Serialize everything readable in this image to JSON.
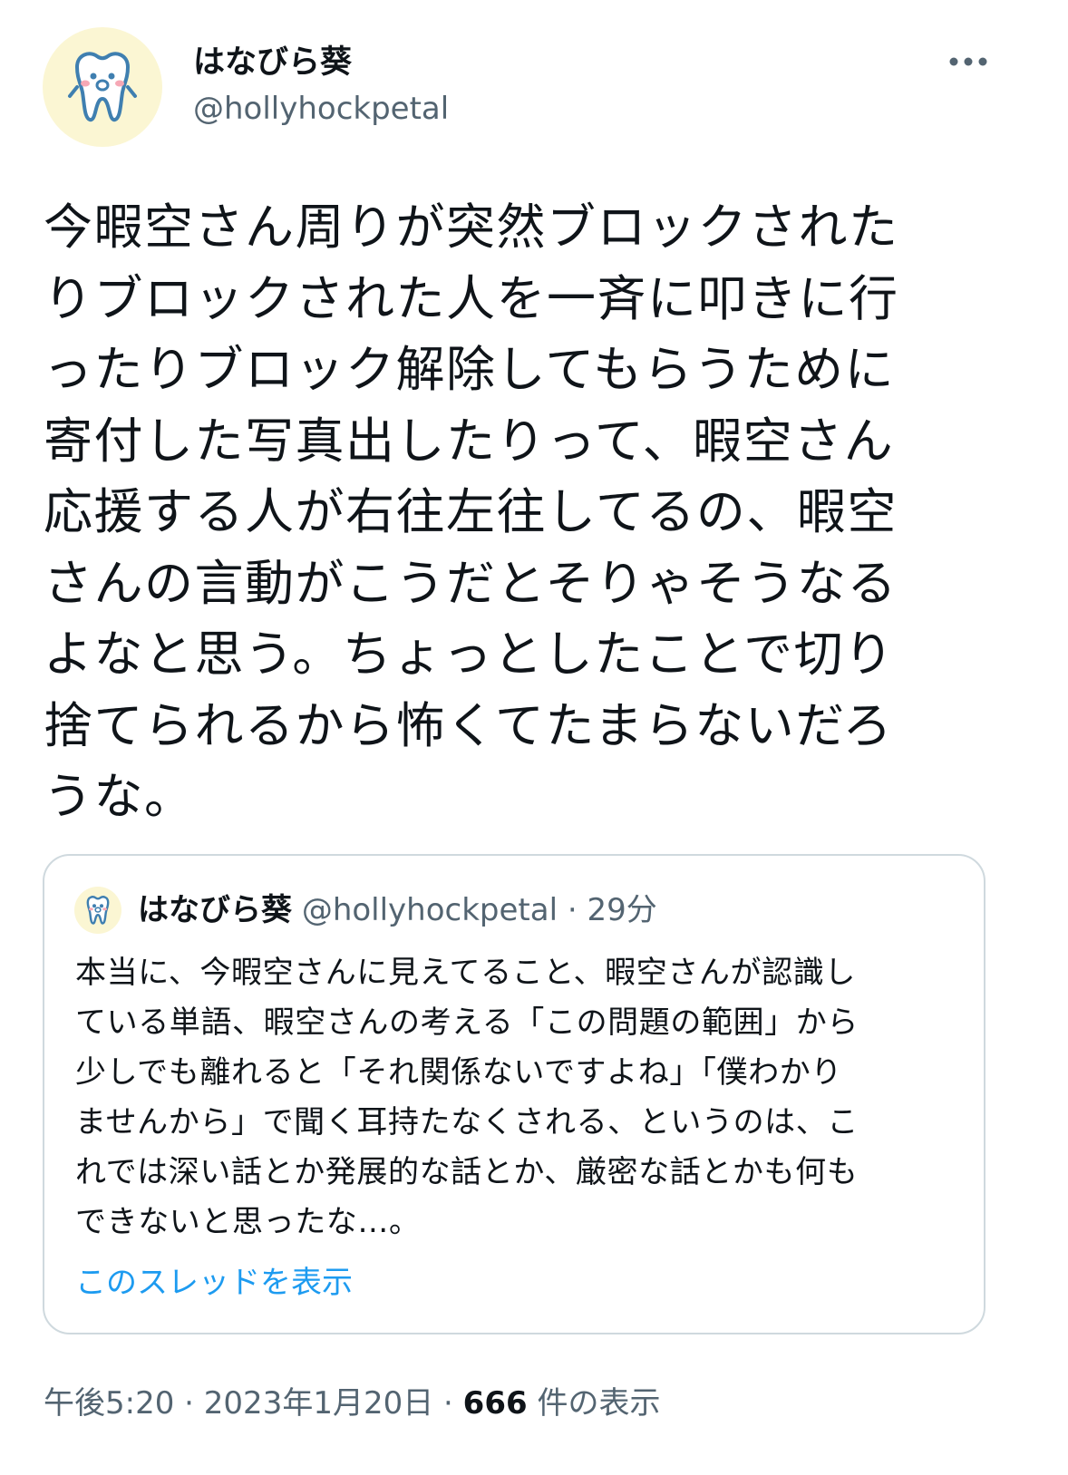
{
  "author": {
    "display_name": "はなびら葵",
    "handle": "@hollyhockpetal",
    "avatar_icon": "tooth-mascot-icon"
  },
  "tweet": {
    "lines": [
      "今暇空さん周りが突然ブロックされた",
      "りブロックされた人を一斉に叩きに行",
      "ったりブロック解除してもらうために",
      "寄付した写真出したりって、暇空さん",
      "応援する人が右往左往してるの、暇空",
      "さんの言動がこうだとそりゃそうなる",
      "よなと思う。ちょっとしたことで切り",
      "捨てられるから怖くてたまらないだろ",
      "うな。"
    ]
  },
  "quote": {
    "display_name": "はなびら葵",
    "handle": "@hollyhockpetal",
    "separator": "·",
    "time": "29分",
    "lines": [
      "本当に、今暇空さんに見えてること、暇空さんが認識し",
      "ている単語、暇空さんの考える「この問題の範囲」から",
      "少しでも離れると「それ関係ないですよね」「僕わかり",
      "ませんから」で聞く耳持たなくされる、というのは、こ",
      "れでは深い話とか発展的な話とか、厳密な話とかも何も",
      "できないと思ったな…。"
    ],
    "show_thread": "このスレッドを表示"
  },
  "meta": {
    "time": "午後5:20",
    "sep1": "·",
    "date": "2023年1月20日",
    "sep2": "·",
    "views_count": "666",
    "views_label": "件の表示"
  },
  "colors": {
    "text": "#0f1419",
    "secondary": "#536471",
    "link": "#1d9bf0",
    "border": "#cfd9de",
    "avatar_bg": "#fbf6d3",
    "mascot_stroke": "#3f7fb0"
  }
}
